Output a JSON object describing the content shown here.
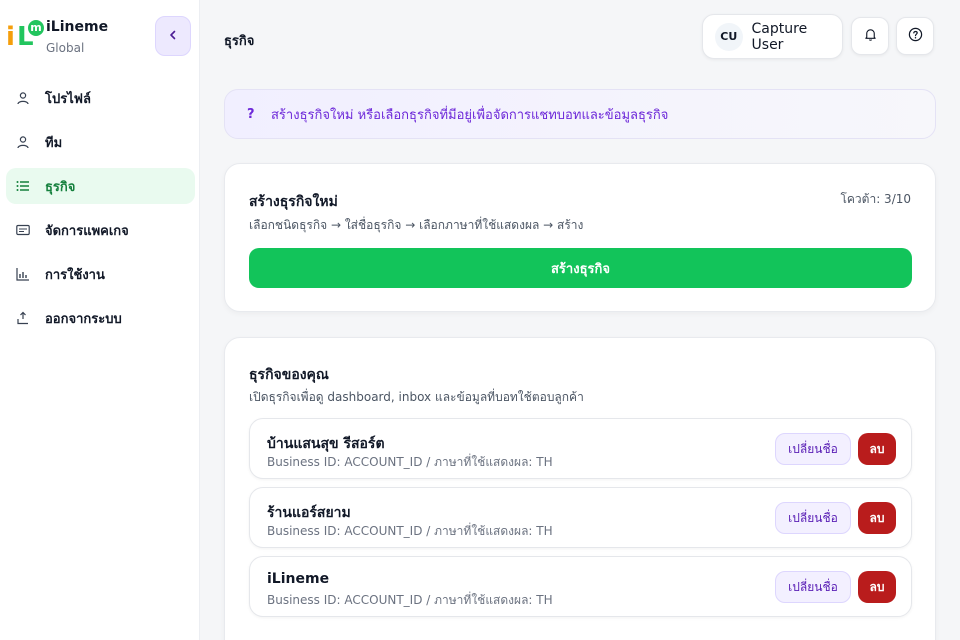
{
  "brand": {
    "name": "iLineme",
    "sub": "Global",
    "logo_i": "i",
    "logo_l": "L",
    "logo_m": "m"
  },
  "sidebar": {
    "collapse_icon": "chevron-left-icon",
    "items": [
      {
        "label": "โปรไฟล์",
        "icon": "user-icon",
        "active": false
      },
      {
        "label": "ทีม",
        "icon": "user-icon",
        "active": false
      },
      {
        "label": "ธุรกิจ",
        "icon": "list-icon",
        "active": true
      },
      {
        "label": "จัดการแพคเกจ",
        "icon": "card-icon",
        "active": false
      },
      {
        "label": "การใช้งาน",
        "icon": "bar-chart-icon",
        "active": false
      },
      {
        "label": "ออกจากระบบ",
        "icon": "logout-icon",
        "active": false
      }
    ]
  },
  "header": {
    "title": "ธุรกิจ",
    "user_initials": "CU",
    "user_name": "Capture User",
    "bell_icon": "bell-icon",
    "help_icon": "help-icon"
  },
  "banner": {
    "icon": "?",
    "text": "สร้างธุรกิจใหม่ หรือเลือกธุรกิจที่มีอยู่เพื่อจัดการแชทบอทและข้อมูลธุรกิจ"
  },
  "create": {
    "title": "สร้างธุรกิจใหม่",
    "steps": "เลือกชนิดธุรกิจ → ใส่ชื่อธุรกิจ → เลือกภาษาที่ใช้แสดงผล → สร้าง",
    "quota": "โควต้า: 3/10",
    "button": "สร้างธุรกิจ"
  },
  "list": {
    "title": "ธุรกิจของคุณ",
    "subtitle": "เปิดธุรกิจเพื่อดู dashboard, inbox และข้อมูลที่บอทใช้ตอบลูกค้า",
    "rename_label": "เปลี่ยนชื่อ",
    "delete_label": "ลบ",
    "businesses": [
      {
        "name": "บ้านแสนสุข รีสอร์ต",
        "meta": "Business ID: ACCOUNT_ID / ภาษาที่ใช้แสดงผล: TH"
      },
      {
        "name": "ร้านแอร์สยาม",
        "meta": "Business ID: ACCOUNT_ID / ภาษาที่ใช้แสดงผล: TH"
      },
      {
        "name": "iLineme",
        "meta": "Business ID: ACCOUNT_ID / ภาษาที่ใช้แสดงผล: TH"
      }
    ]
  },
  "colors": {
    "accent_green": "#12c45a",
    "accent_purple": "#6d28d9",
    "danger": "#b91c1c"
  }
}
